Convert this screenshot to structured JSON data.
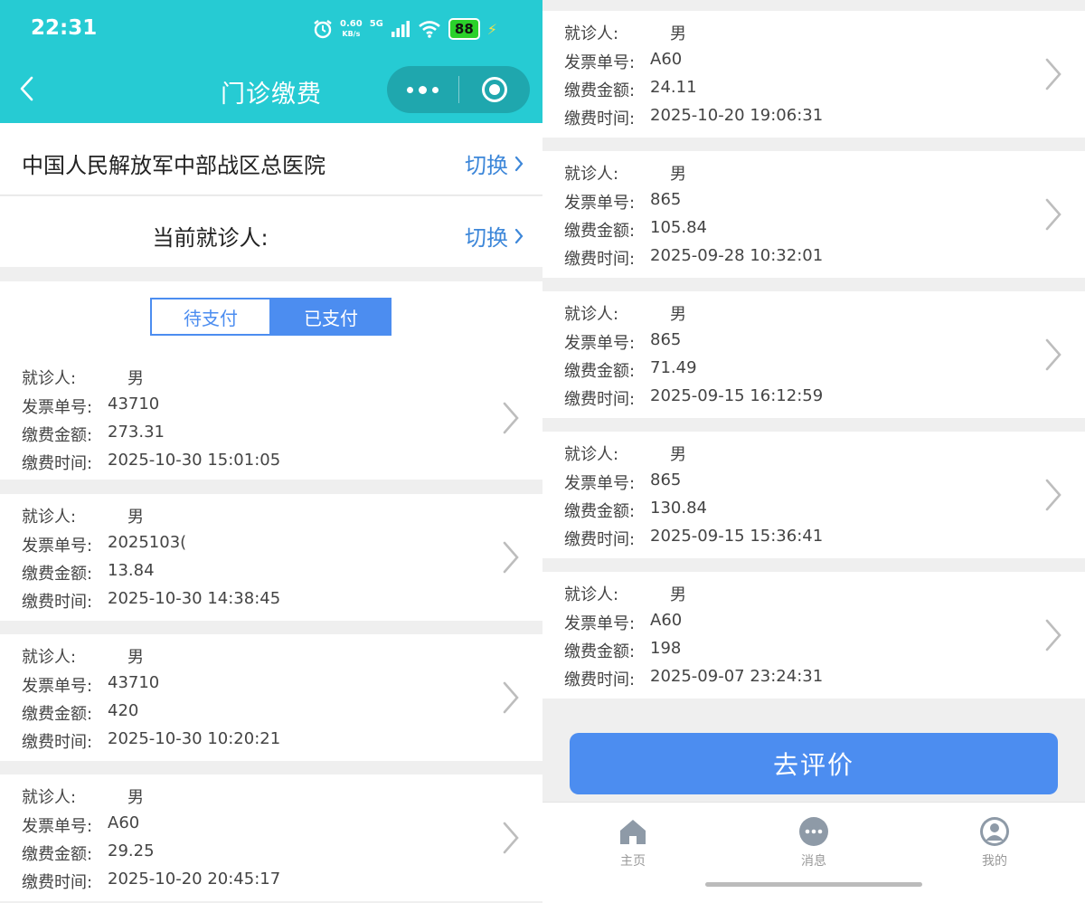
{
  "status_bar": {
    "time": "22:31",
    "net_speed_value": "0.60",
    "net_speed_unit": "KB/s",
    "network": "5G",
    "battery": "88"
  },
  "nav": {
    "title": "门诊缴费"
  },
  "hospital": {
    "name": "中国人民解放军中部战区总医院",
    "switch_label": "切换"
  },
  "patient": {
    "label": "当前就诊人:",
    "switch_label": "切换"
  },
  "tabs": [
    {
      "label": "待支付",
      "active": false
    },
    {
      "label": "已支付",
      "active": true
    }
  ],
  "field_labels": {
    "patient": "就诊人:",
    "invoice": "发票单号:",
    "amount": "缴费金额:",
    "time": "缴费时间:"
  },
  "left_records": [
    {
      "patient": "男",
      "invoice": "43710",
      "amount": "273.31",
      "time": "2025-10-30 15:01:05"
    },
    {
      "patient": "男",
      "invoice": "2025103(",
      "amount": "13.84",
      "time": "2025-10-30 14:38:45"
    },
    {
      "patient": "男",
      "invoice": "43710",
      "amount": "420",
      "time": "2025-10-30 10:20:21"
    },
    {
      "patient": "男",
      "invoice": "A60",
      "amount": "29.25",
      "time": "2025-10-20 20:45:17"
    }
  ],
  "right_records": [
    {
      "patient": "男",
      "invoice": "A60",
      "amount": "24.11",
      "time": "2025-10-20 19:06:31"
    },
    {
      "patient": "男",
      "invoice": "865",
      "amount": "105.84",
      "time": "2025-09-28 10:32:01"
    },
    {
      "patient": "男",
      "invoice": "865",
      "amount": "71.49",
      "time": "2025-09-15 16:12:59"
    },
    {
      "patient": "男",
      "invoice": "865",
      "amount": "130.84",
      "time": "2025-09-15 15:36:41"
    },
    {
      "patient": "男",
      "invoice": "A60",
      "amount": "198",
      "time": "2025-09-07 23:24:31"
    }
  ],
  "review_button": "去评价",
  "tabbar": [
    {
      "label": "主页",
      "icon": "home-icon"
    },
    {
      "label": "消息",
      "icon": "message-icon"
    },
    {
      "label": "我的",
      "icon": "profile-icon"
    }
  ],
  "colors": {
    "header": "#26cbd3",
    "accent": "#4c8df0",
    "link": "#3d87d9",
    "page_bg": "#efefef"
  }
}
